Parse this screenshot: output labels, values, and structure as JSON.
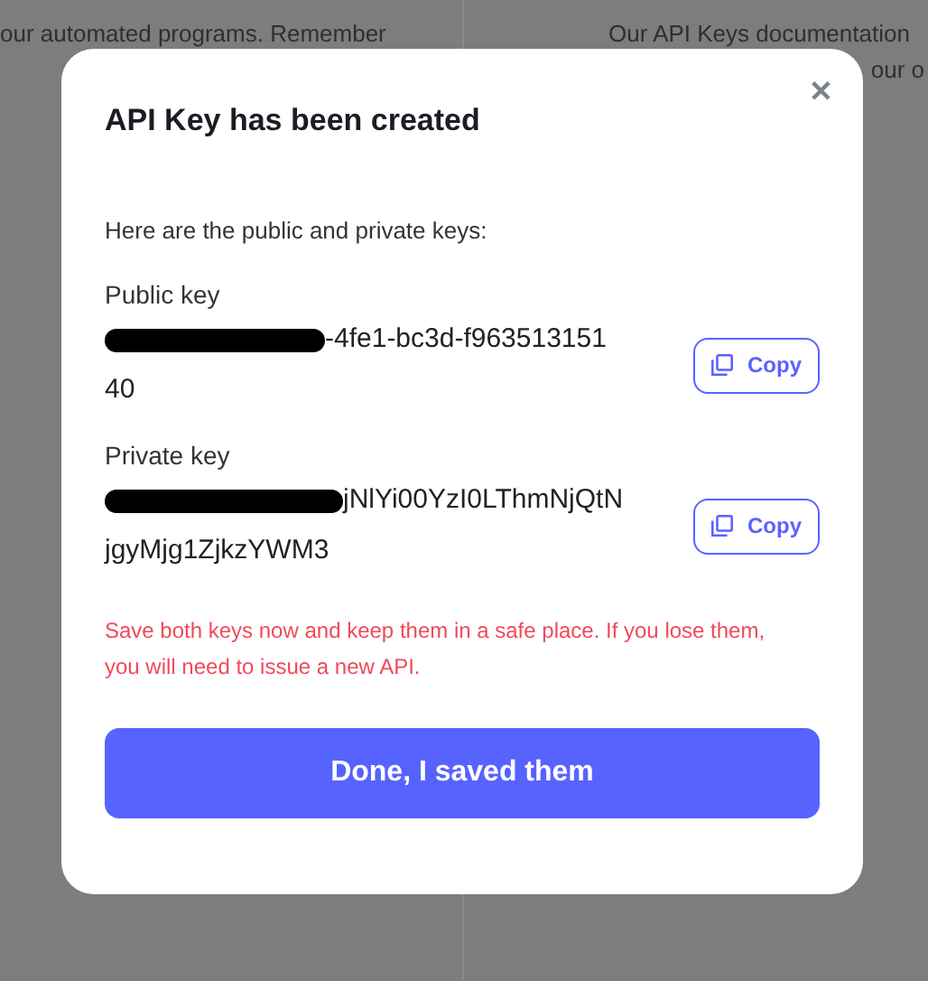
{
  "background": {
    "left_text": "our automated programs. Remember",
    "right_text": "Our API Keys documentation",
    "right_text_2": "our o"
  },
  "dialog": {
    "title": "API Key has been created",
    "close": "✕",
    "intro": "Here are the public and private keys:",
    "keys": [
      {
        "label": "Public key",
        "redacted": true,
        "value_lines": [
          "-4fe1-bc3d-f963513151",
          "40"
        ],
        "copy": "Copy"
      },
      {
        "label": "Private key",
        "redacted": true,
        "value_lines": [
          "jNlYi00YzI0LThmNjQtN",
          "jgyMjg1ZjkzYWM3"
        ],
        "copy": "Copy"
      }
    ],
    "warning": "Save both keys now and keep them in a safe place. If you lose them, you will need to issue a new API.",
    "done_button": "Done, I saved them"
  }
}
